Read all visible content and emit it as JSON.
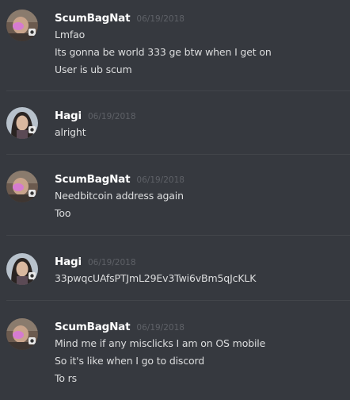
{
  "messages": [
    {
      "author": "ScumBagNat",
      "timestamp": "06/19/2018",
      "avatar_icon": "user-avatar-scumbagnat",
      "lines": [
        "Lmfao",
        "Its gonna be world 333 ge btw when I  get on",
        "User is ub scum"
      ]
    },
    {
      "author": "Hagi",
      "timestamp": "06/19/2018",
      "avatar_icon": "user-avatar-hagi",
      "lines": [
        "alright"
      ]
    },
    {
      "author": "ScumBagNat",
      "timestamp": "06/19/2018",
      "avatar_icon": "user-avatar-scumbagnat",
      "lines": [
        "Needbitcoin address again",
        "Too"
      ]
    },
    {
      "author": "Hagi",
      "timestamp": "06/19/2018",
      "avatar_icon": "user-avatar-hagi",
      "lines": [
        "33pwqcUAfsPTJmL29Ev3Twi6vBm5qJcKLK"
      ]
    },
    {
      "author": "ScumBagNat",
      "timestamp": "06/19/2018",
      "avatar_icon": "user-avatar-scumbagnat",
      "lines": [
        "Mind me if any misclicks I am on OS mobile",
        "So it's like when I go to discord",
        "To rs"
      ]
    }
  ],
  "colors": {
    "background": "#36393f",
    "username": "#ffffff",
    "timestamp": "#5e6167",
    "message_text": "#dcddde",
    "divider": "#42454a"
  }
}
